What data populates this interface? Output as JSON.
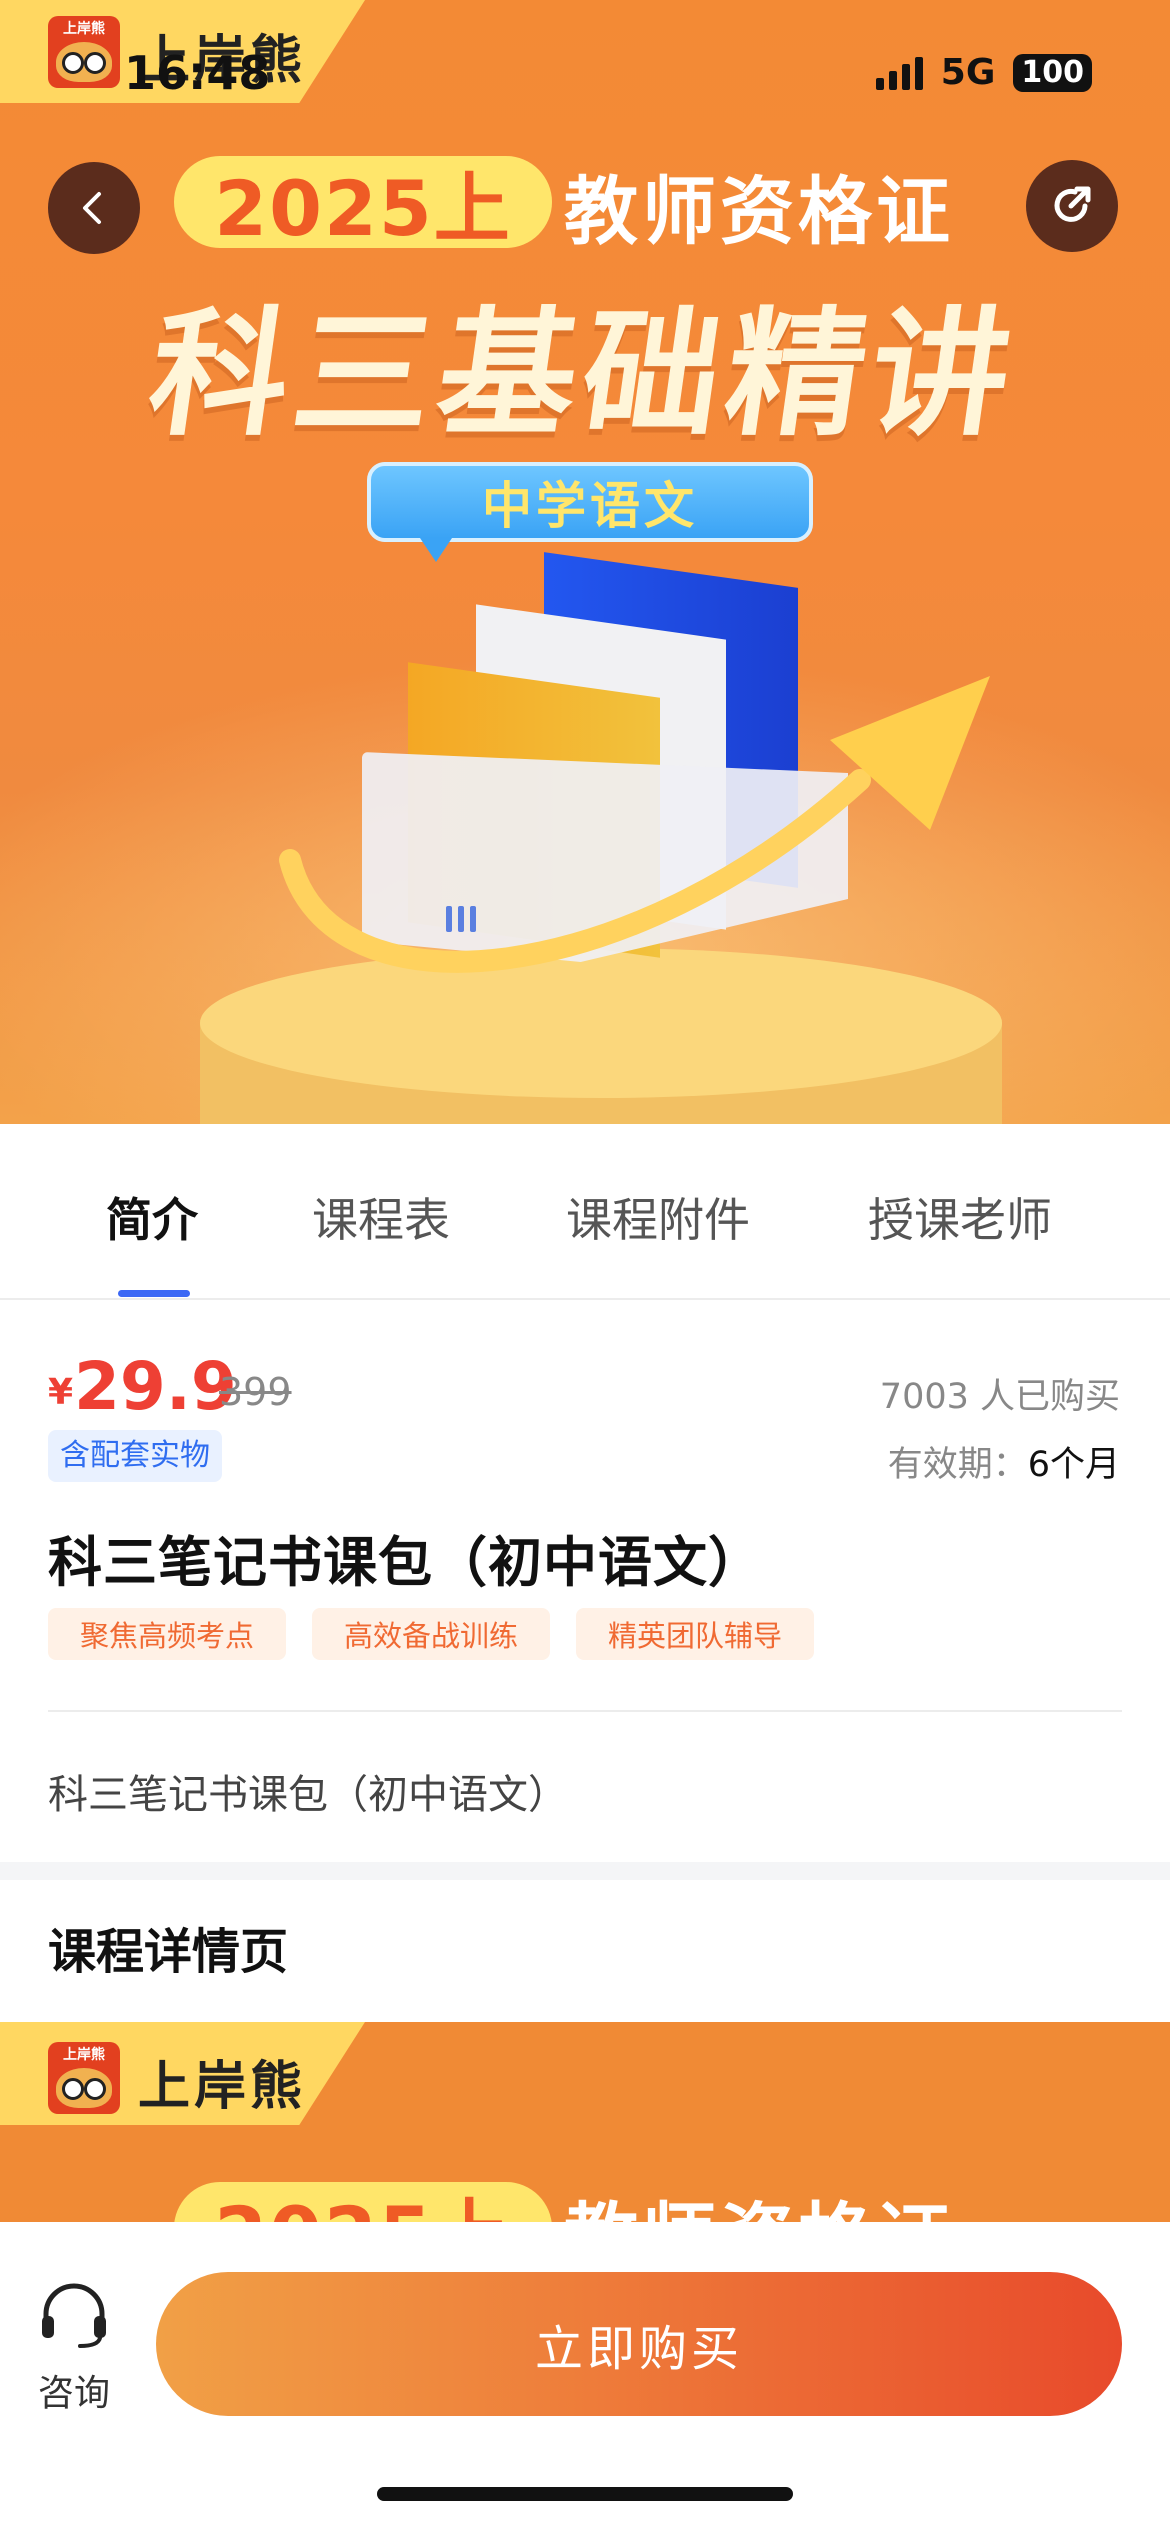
{
  "status_bar": {
    "time": "16:48",
    "network": "5G",
    "battery": "100"
  },
  "brand": {
    "name": "上岸熊",
    "logo_text": "上岸熊"
  },
  "hero": {
    "year_label": "2025上",
    "cert_label": "教师资格证",
    "main_title": "科三基础精讲",
    "subject": "中学语文"
  },
  "tabs": [
    {
      "label": "简介",
      "active": true
    },
    {
      "label": "课程表",
      "active": false
    },
    {
      "label": "课程附件",
      "active": false
    },
    {
      "label": "授课老师",
      "active": false
    }
  ],
  "product": {
    "currency": "¥",
    "price": "29.9",
    "original_price": "399",
    "sold_count": "7003 人已购买",
    "validity_label": "有效期：",
    "validity_value": "6个月",
    "badge": "含配套实物",
    "title": "科三笔记书课包（初中语文）",
    "tags": [
      "聚焦高频考点",
      "高效备战训练",
      "精英团队辅导"
    ],
    "description": "科三笔记书课包（初中语文）"
  },
  "detail_section": {
    "title": "课程详情页"
  },
  "bottom_bar": {
    "consult_label": "咨询",
    "buy_label": "立即购买"
  },
  "colors": {
    "accent_orange": "#f38a35",
    "price_red": "#ee4034",
    "tab_indicator": "#3c68f5"
  }
}
